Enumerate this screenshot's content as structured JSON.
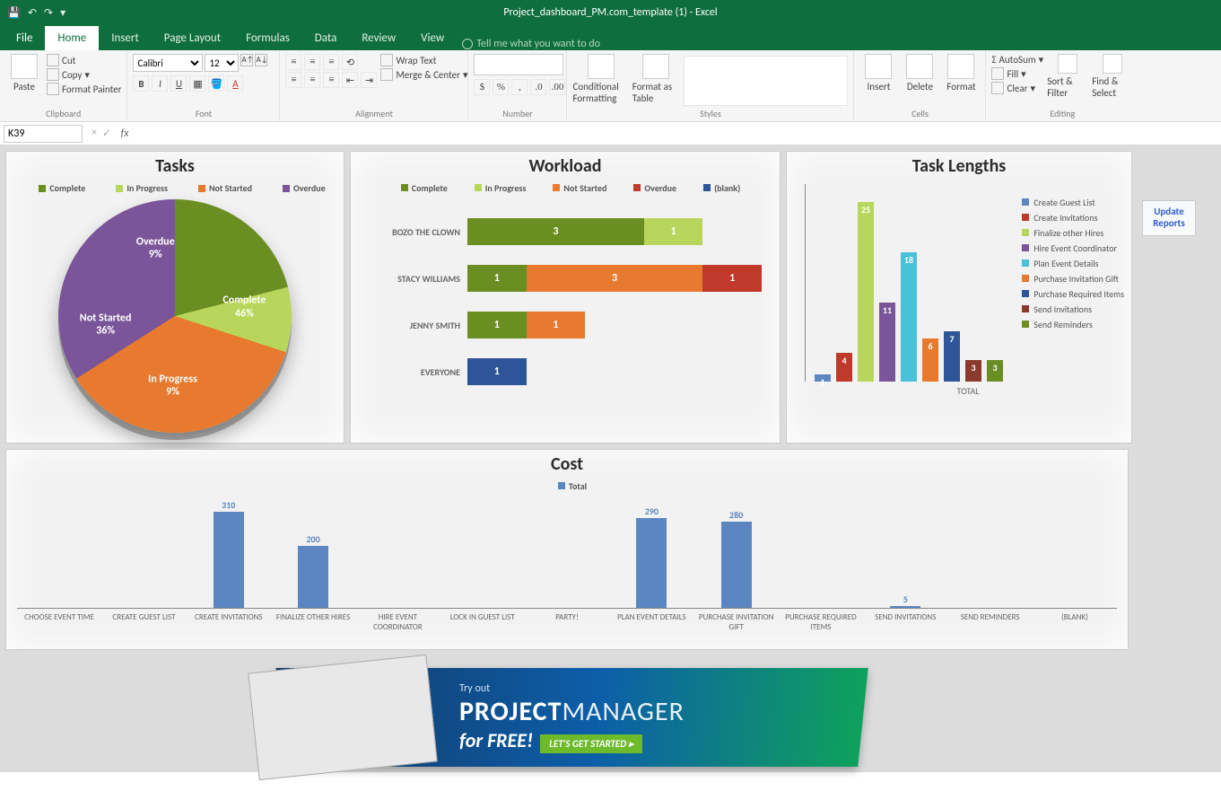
{
  "app": {
    "document_title": "Project_dashboard_PM.com_template (1) - Excel",
    "cell_ref": "K39"
  },
  "tabs": {
    "file": "File",
    "home": "Home",
    "insert": "Insert",
    "page_layout": "Page Layout",
    "formulas": "Formulas",
    "data": "Data",
    "review": "Review",
    "view": "View",
    "tell_me": "Tell me what you want to do"
  },
  "ribbon": {
    "clipboard": {
      "label": "Clipboard",
      "paste": "Paste",
      "cut": "Cut",
      "copy": "Copy",
      "format_painter": "Format Painter"
    },
    "font": {
      "label": "Font",
      "name": "Calibri",
      "size": "12"
    },
    "alignment": {
      "label": "Alignment",
      "wrap": "Wrap Text",
      "merge": "Merge & Center"
    },
    "number": {
      "label": "Number"
    },
    "styles_group": {
      "label": "Styles",
      "cond": "Conditional Formatting",
      "table": "Format as Table"
    },
    "cells": {
      "label": "Cells",
      "insert": "Insert",
      "delete": "Delete",
      "format": "Format"
    },
    "editing": {
      "label": "Editing",
      "autosum": "AutoSum",
      "fill": "Fill",
      "clear": "Clear",
      "sort": "Sort & Filter",
      "find": "Find & Select"
    }
  },
  "update_btn": "Update Reports",
  "chart_data": [
    {
      "type": "pie",
      "title": "Tasks",
      "legend": [
        "Complete",
        "In Progress",
        "Not Started",
        "Overdue"
      ],
      "legend_colors": [
        "#6b8e23",
        "#b8d65b",
        "#e77a2e",
        "#7b559a"
      ],
      "slices": [
        {
          "name": "Complete",
          "value": 46,
          "color": "#6b8e23"
        },
        {
          "name": "In Progress",
          "value": 9,
          "color": "#b8d65b"
        },
        {
          "name": "Not Started",
          "value": 36,
          "color": "#e77a2e"
        },
        {
          "name": "Overdue",
          "value": 9,
          "color": "#7b559a"
        }
      ]
    },
    {
      "type": "bar",
      "orientation": "horizontal-stacked",
      "title": "Workload",
      "legend": [
        "Complete",
        "In Progress",
        "Not Started",
        "Overdue",
        "(blank)"
      ],
      "legend_colors": [
        "#6b8e23",
        "#b8d65b",
        "#e77a2e",
        "#c0392b",
        "#2e5597"
      ],
      "categories": [
        "BOZO THE CLOWN",
        "STACY WILLIAMS",
        "JENNY SMITH",
        "EVERYONE"
      ],
      "series": [
        {
          "name": "Complete",
          "color": "#6b8e23",
          "values": [
            3,
            1,
            1,
            0
          ]
        },
        {
          "name": "In Progress",
          "color": "#b8d65b",
          "values": [
            1,
            0,
            0,
            0
          ]
        },
        {
          "name": "Not Started",
          "color": "#e77a2e",
          "values": [
            0,
            3,
            1,
            0
          ]
        },
        {
          "name": "Overdue",
          "color": "#c0392b",
          "values": [
            0,
            1,
            0,
            0
          ]
        },
        {
          "name": "(blank)",
          "color": "#2e5597",
          "values": [
            0,
            0,
            0,
            1
          ]
        }
      ],
      "xlim": [
        0,
        5
      ]
    },
    {
      "type": "bar",
      "title": "Task Lengths",
      "xlabel": "TOTAL",
      "categories": [
        "Create Guest List",
        "Create Invitations",
        "Finalize other Hires",
        "Hire Event Coordinator",
        "Plan Event Details",
        "Purchase Invitation Gift",
        "Purchase Required Items",
        "Send Invitations",
        "Send Reminders"
      ],
      "colors": [
        "#5b86c2",
        "#c0392b",
        "#b8d65b",
        "#7b559a",
        "#4bc0d9",
        "#e77a2e",
        "#2e5597",
        "#8b3a2e",
        "#6b8e23"
      ],
      "values": [
        1,
        4,
        25,
        11,
        18,
        6,
        7,
        3,
        3
      ],
      "ylim": [
        0,
        25
      ]
    },
    {
      "type": "bar",
      "title": "Cost",
      "legend": [
        "Total"
      ],
      "legend_colors": [
        "#5b86c2"
      ],
      "categories": [
        "CHOOSE EVENT TIME",
        "CREATE GUEST LIST",
        "CREATE INVITATIONS",
        "FINALIZE OTHER HIRES",
        "HIRE EVENT COORDINATOR",
        "LOCK IN GUEST LIST",
        "PARTY!",
        "PLAN EVENT DETAILS",
        "PURCHASE INVITATION GIFT",
        "PURCHASE REQUIRED ITEMS",
        "SEND INVITATIONS",
        "SEND REMINDERS",
        "(BLANK)"
      ],
      "values": [
        0,
        0,
        310,
        200,
        0,
        0,
        0,
        290,
        280,
        0,
        5,
        0,
        0
      ],
      "ylim": [
        0,
        320
      ]
    }
  ],
  "banner": {
    "tag": "Try out",
    "brand1": "PROJECT",
    "brand2": "MANAGER",
    "sub": "for FREE!",
    "cta": "LET'S GET STARTED"
  }
}
